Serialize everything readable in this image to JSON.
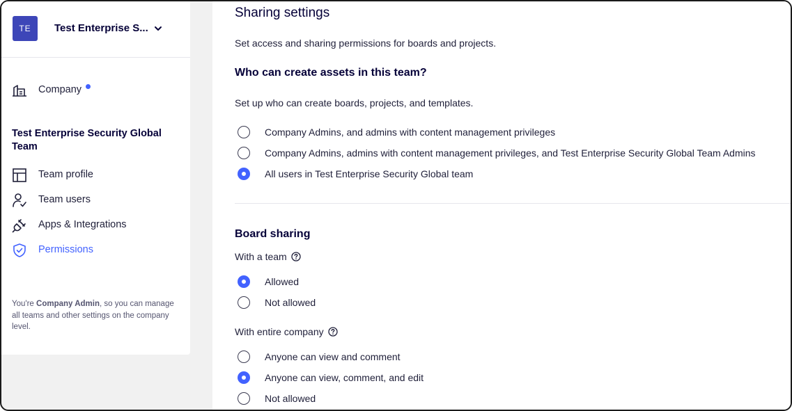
{
  "sidebar": {
    "team_initials": "TE",
    "team_name": "Test Enterprise S...",
    "company_label": "Company",
    "section_title": "Test Enterprise Security Global Team",
    "items": [
      {
        "label": "Team profile",
        "icon": "layout-icon"
      },
      {
        "label": "Team users",
        "icon": "user-check-icon"
      },
      {
        "label": "Apps & Integrations",
        "icon": "plug-icon"
      },
      {
        "label": "Permissions",
        "icon": "shield-check-icon",
        "active": true
      }
    ],
    "admin_note": {
      "prefix": "You're ",
      "role": "Company Admin",
      "suffix": ", so you can manage all teams and other settings on the company level."
    }
  },
  "main": {
    "title": "Sharing settings",
    "description": "Set access and sharing permissions for boards and projects.",
    "create_assets": {
      "heading": "Who can create assets in this team?",
      "description": "Set up who can create boards, projects, and templates.",
      "options": [
        "Company Admins, and admins with content management privileges",
        "Company Admins, admins with content management privileges, and Test Enterprise Security Global Team Admins",
        "All users in Test Enterprise Security Global team"
      ],
      "selected_index": 2
    },
    "board_sharing": {
      "heading": "Board sharing",
      "with_team": {
        "label": "With a team",
        "options": [
          "Allowed",
          "Not allowed"
        ],
        "selected_index": 0
      },
      "with_company": {
        "label": "With entire company",
        "options": [
          "Anyone can view and comment",
          "Anyone can view, comment, and edit",
          "Not allowed"
        ],
        "selected_index": 1
      }
    }
  },
  "colors": {
    "accent": "#4262ff",
    "avatar_bg": "#3d46b8",
    "text_primary": "#050038"
  }
}
